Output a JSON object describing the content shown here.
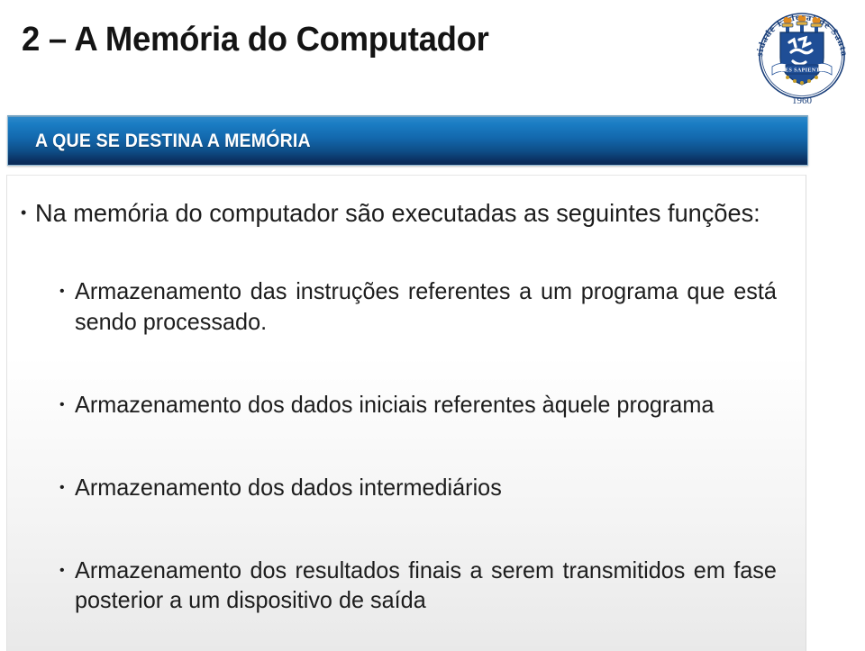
{
  "slide": {
    "title": "2 – A Memória do Computador",
    "section_banner": {
      "label": "A QUE SE DESTINA  A MEMÓRIA",
      "gradient_top_color": "#2d88c9",
      "gradient_bottom_color": "#0a2a56",
      "text_color": "#ffffff"
    },
    "logo": {
      "name": "ufsm-seal-logo",
      "ring_text_top": "Universidade Federal de Santa Maria",
      "motto_banner": "SEDES SAPIENTIAE",
      "year": "1960",
      "shield_color": "#1f4e96",
      "ring_text_color": "#1a3f7a",
      "flame_color": "#e08a1e"
    },
    "bullets": [
      {
        "level": 1,
        "marker": "•",
        "text": "Na memória do computador são executadas as seguintes funções:",
        "justified": true
      },
      {
        "level": 2,
        "marker": "•",
        "text": "Armazenamento das instruções referentes a um programa que está sendo processado.",
        "justified": true
      },
      {
        "level": 2,
        "marker": "•",
        "text": "Armazenamento dos dados iniciais referentes àquele programa",
        "justified": true
      },
      {
        "level": 2,
        "marker": "•",
        "text": "Armazenamento dos dados intermediários",
        "justified": false
      },
      {
        "level": 2,
        "marker": "•",
        "text": "Armazenamento dos resultados finais a serem transmitidos em fase posterior a um dispositivo de saída",
        "justified": true
      }
    ]
  }
}
